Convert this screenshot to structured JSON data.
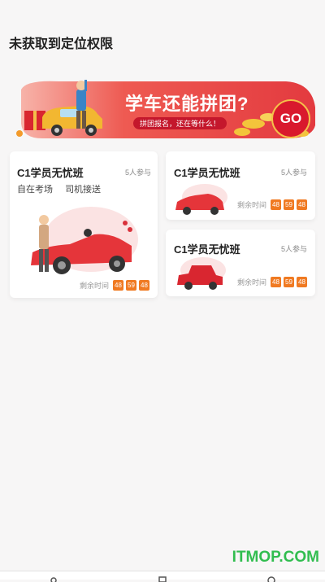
{
  "location_status": "未获取到定位权限",
  "banner": {
    "title": "学车还能拼团?",
    "subtitle": "拼团报名，还在等什么！",
    "go_label": "GO"
  },
  "cards": [
    {
      "title": "C1学员无忧班",
      "participants": "5人参与",
      "tags": [
        "自在考场",
        "司机接送"
      ],
      "countdown_label": "剩余时间",
      "countdown": [
        "48",
        "59",
        "48"
      ]
    },
    {
      "title": "C1学员无忧班",
      "participants": "5人参与",
      "countdown_label": "剩余时间",
      "countdown": [
        "48",
        "59",
        "48"
      ]
    },
    {
      "title": "C1学员无忧班",
      "participants": "5人参与",
      "countdown_label": "剩余时间",
      "countdown": [
        "48",
        "59",
        "48"
      ]
    }
  ],
  "watermark": "ITMOP.COM",
  "colors": {
    "accent_red": "#e8333b",
    "timer_orange": "#f07a22",
    "watermark_green": "#31bd4f"
  }
}
